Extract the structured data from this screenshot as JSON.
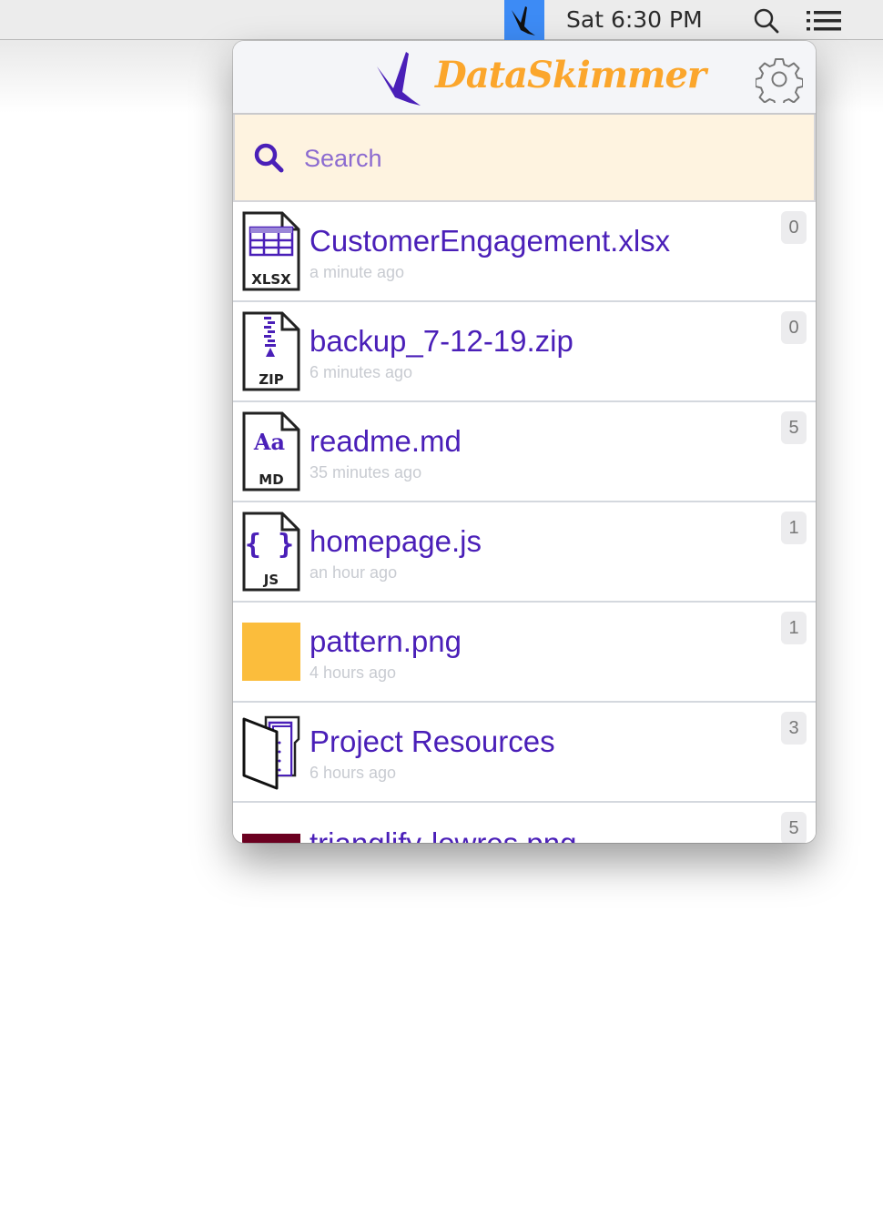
{
  "menubar": {
    "clock": "Sat 6:30 PM",
    "app_icon": "bird-icon",
    "search_icon": "spotlight-search-icon",
    "list_icon": "notification-list-icon",
    "app_highlight_color": "#3d8bf5"
  },
  "header": {
    "title": "DataSkimmer",
    "logo_icon": "bird-icon",
    "settings_icon": "gear-icon",
    "title_color": "#fba62c",
    "brand_color": "#4a1fb8"
  },
  "search": {
    "placeholder": "Search",
    "value": "",
    "background_color": "#fef3e0"
  },
  "files": [
    {
      "name": "CustomerEngagement.xlsx",
      "time": "a minute ago",
      "count": "0",
      "icon": "xlsx-file-icon",
      "icon_label": "XLSX"
    },
    {
      "name": "backup_7-12-19.zip",
      "time": "6 minutes ago",
      "count": "0",
      "icon": "zip-file-icon",
      "icon_label": "ZIP"
    },
    {
      "name": "readme.md",
      "time": "35 minutes ago",
      "count": "5",
      "icon": "md-file-icon",
      "icon_label": "MD",
      "glyph": "Aa"
    },
    {
      "name": "homepage.js",
      "time": "an hour ago",
      "count": "1",
      "icon": "js-file-icon",
      "icon_label": "JS",
      "glyph": "{ }"
    },
    {
      "name": "pattern.png",
      "time": "4 hours ago",
      "count": "1",
      "icon": "image-thumbnail-icon",
      "thumb_color": "#fbbd3c"
    },
    {
      "name": "Project Resources",
      "time": "6 hours ago",
      "count": "3",
      "icon": "folder-icon"
    },
    {
      "name": "trianglify-lowres.png",
      "time": "",
      "count": "5",
      "icon": "image-thumbnail-icon",
      "thumb_color": "#6b0020"
    }
  ]
}
